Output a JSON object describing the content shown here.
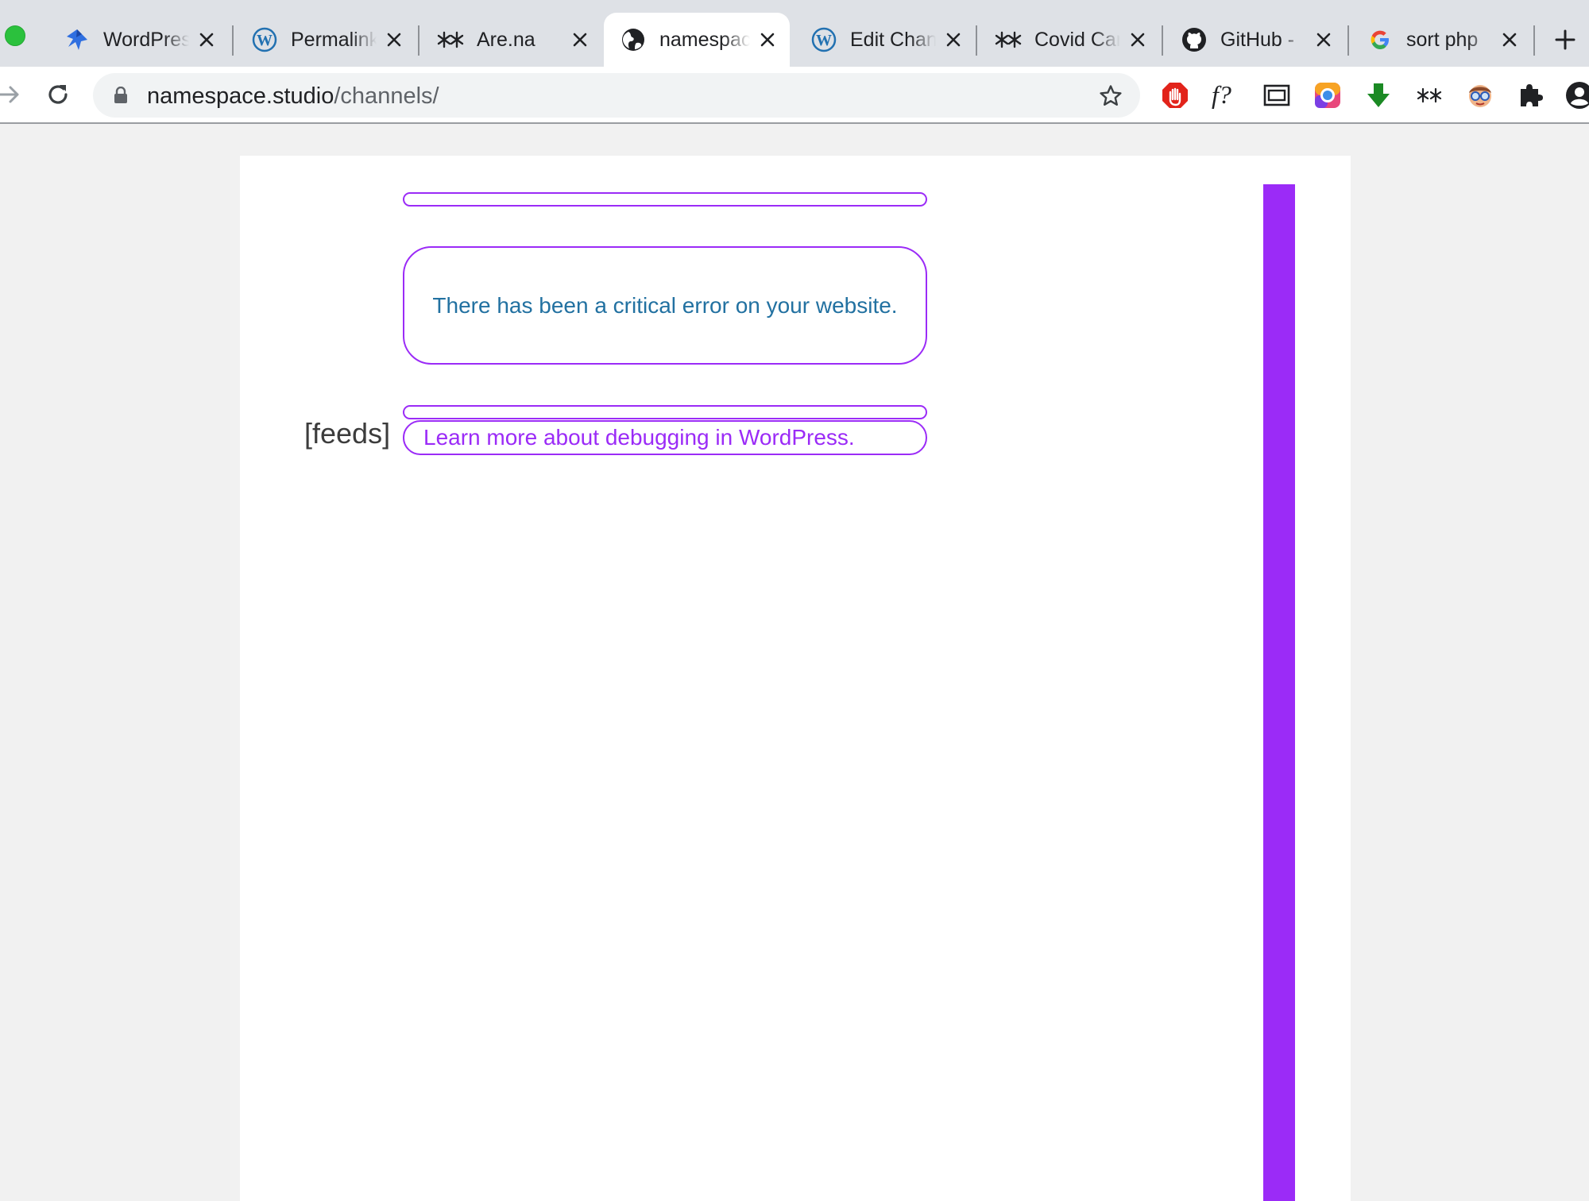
{
  "browser": {
    "tabs": [
      {
        "title": "WordPress",
        "icon": "pin-icon"
      },
      {
        "title": "Permalinks",
        "icon": "wordpress-icon"
      },
      {
        "title": "Are.na",
        "icon": "arena-icon"
      },
      {
        "title": "namespace",
        "icon": "globe-icon",
        "active": true
      },
      {
        "title": "Edit Channel",
        "icon": "wordpress-icon"
      },
      {
        "title": "Covid Care",
        "icon": "arena-icon"
      },
      {
        "title": "GitHub - ",
        "icon": "github-icon"
      },
      {
        "title": "sort php",
        "icon": "google-icon"
      }
    ],
    "url": {
      "host": "namespace.studio",
      "path": "/channels/"
    },
    "colors": {
      "tabstrip": "#dee1e6",
      "accent_purple": "#9b2bf7",
      "error_text": "#2271a1"
    }
  },
  "page": {
    "error_message": "There has been a critical error on your website.",
    "feeds_label": "[feeds]",
    "learn_more_link": "Learn more about debugging in WordPress."
  }
}
